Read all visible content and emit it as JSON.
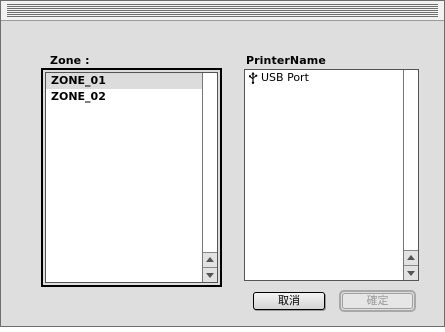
{
  "dialog": {
    "title": "",
    "zone_label": "Zone :",
    "printer_label": "PrinterName",
    "zones": [
      {
        "name": "ZONE_01",
        "selected": true
      },
      {
        "name": "ZONE_02",
        "selected": false
      }
    ],
    "printers": [
      {
        "name": "USB Port",
        "icon": "usb-icon"
      }
    ],
    "cancel_label": "取消",
    "ok_label": "確定",
    "ok_enabled": false
  }
}
